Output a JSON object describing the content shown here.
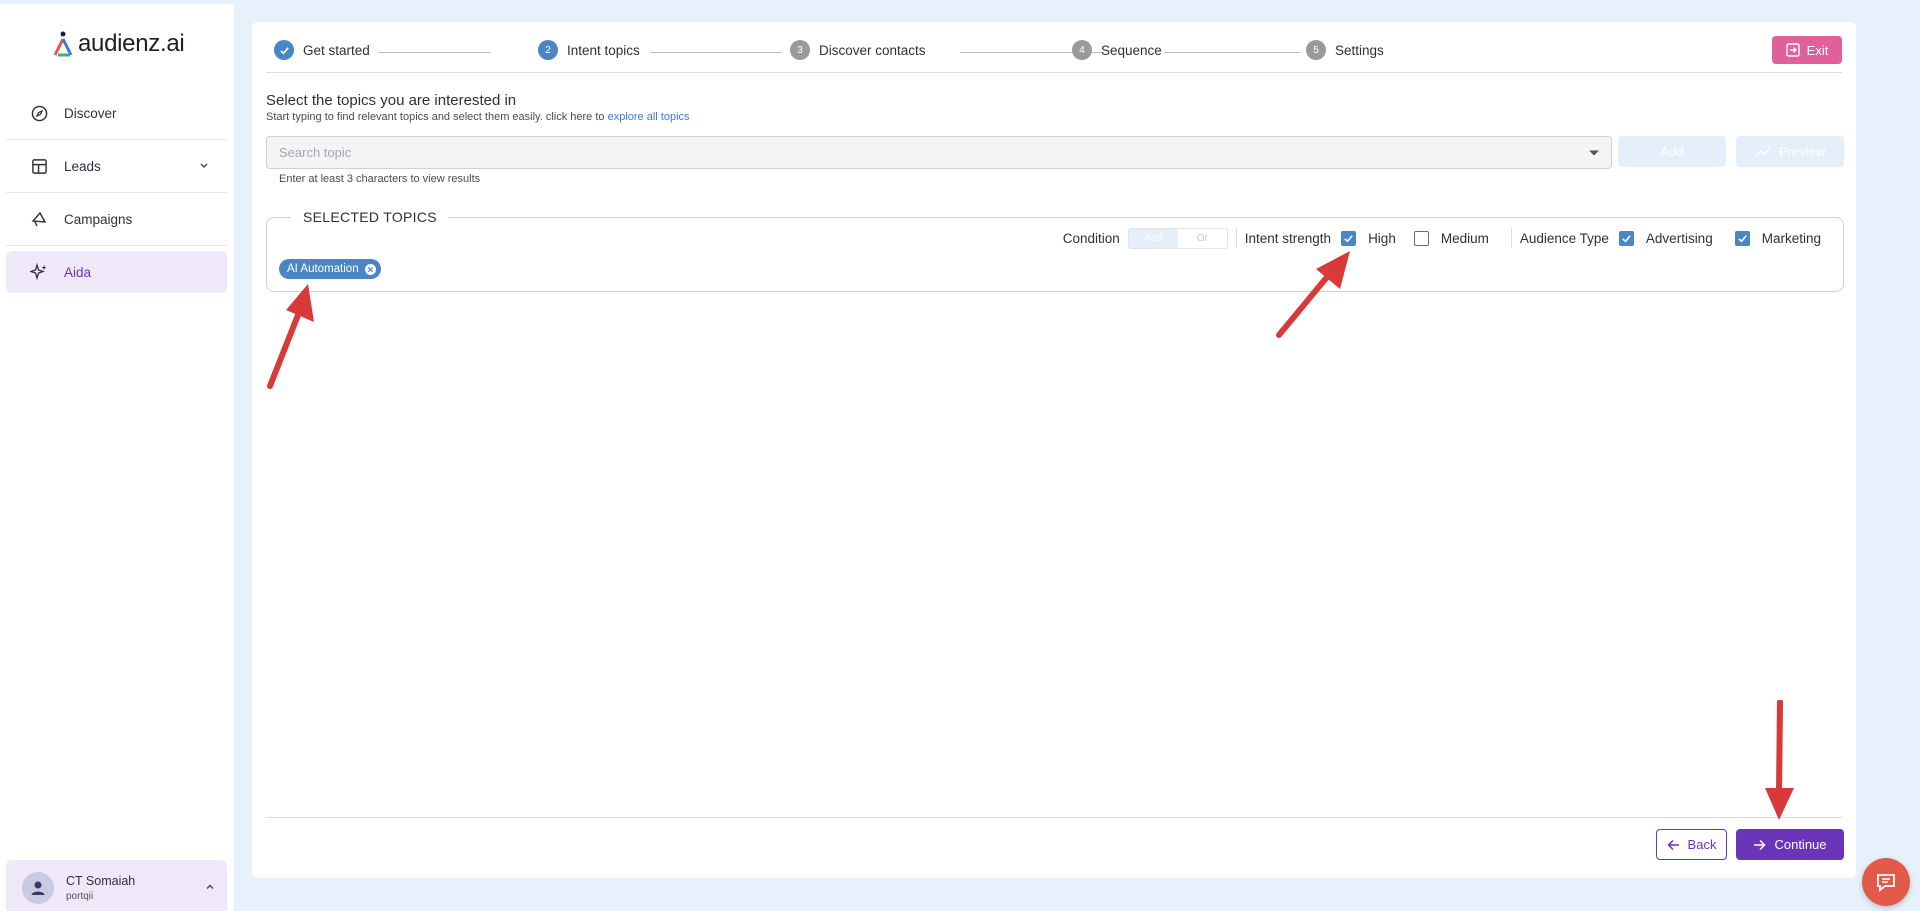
{
  "brand": {
    "name": "audienz.ai"
  },
  "sidebar": {
    "items": [
      {
        "label": "Discover",
        "icon": "compass-icon"
      },
      {
        "label": "Leads",
        "icon": "table-icon"
      },
      {
        "label": "Campaigns",
        "icon": "megaphone-icon"
      },
      {
        "label": "Aida",
        "icon": "sparkle-icon"
      }
    ],
    "user": {
      "name": "CT Somaiah",
      "org": "portqii"
    }
  },
  "stepper": {
    "steps": [
      {
        "num": "1",
        "label": "Get started",
        "state": "done"
      },
      {
        "num": "2",
        "label": "Intent topics",
        "state": "current"
      },
      {
        "num": "3",
        "label": "Discover contacts",
        "state": "todo"
      },
      {
        "num": "4",
        "label": "Sequence",
        "state": "todo"
      },
      {
        "num": "5",
        "label": "Settings",
        "state": "todo"
      }
    ],
    "exit_label": "Exit"
  },
  "main": {
    "heading": "Select the topics you are interested in",
    "subheading": "Start typing to find relevant topics and select them easily. click here to",
    "subheading_link": "explore all topics",
    "search_placeholder": "Search topic",
    "add_label": "Add",
    "preview_label": "Preview",
    "hint": "Enter at least 3 characters to view results"
  },
  "selected_topics": {
    "title": "SELECTED TOPICS",
    "condition_label": "Condition",
    "condition_options": [
      "And",
      "Or"
    ],
    "intent_label": "Intent strength",
    "intent_high": "High",
    "intent_medium": "Medium",
    "audience_label": "Audience Type",
    "audience_advertising": "Advertising",
    "audience_marketing": "Marketing",
    "chips": [
      "AI Automation"
    ]
  },
  "footer": {
    "back_label": "Back",
    "continue_label": "Continue"
  },
  "colors": {
    "primary": "#6a35b8",
    "accent": "#4a86c5",
    "exit": "#e0609a",
    "annotation": "#d83a3a"
  }
}
